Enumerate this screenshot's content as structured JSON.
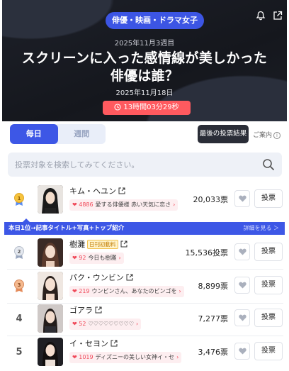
{
  "header": {
    "category_tag": "俳優・映画・ドラマ女子",
    "week_label": "2025年11月3週目",
    "title_line1": "スクリーンに入った感情線が美しかった",
    "title_line2": "俳優は誰？",
    "date": "2025年11月18日",
    "countdown": "13時間03分29秒",
    "icons": [
      "bell-icon",
      "share-icon"
    ]
  },
  "tabs": [
    {
      "label": "毎日",
      "active": true
    },
    {
      "label": "週間",
      "active": false
    }
  ],
  "last_result_label": "最後の投票結果",
  "guide_label": "ご案内",
  "search": {
    "placeholder": "投票対象を検索してみてください。"
  },
  "feature_banner": {
    "text": "本日1位→記事タイトル+写真+トップ紹介",
    "more": "詳細を見る ＞"
  },
  "vote_label": "投票",
  "rows": [
    {
      "rank": "1",
      "name": "キム・ヘユン",
      "badge": "",
      "comment_count": "4886",
      "comment": "愛する俳優様 赤い天気に恋さ",
      "votes": "20,033票"
    },
    {
      "rank": "2",
      "name": "樹灘",
      "badge": "日刊初動料",
      "comment_count": "92",
      "comment": "今日も樹灘",
      "votes": "15,536投票"
    },
    {
      "rank": "3",
      "name": "パク・ウンビン",
      "badge": "",
      "comment_count": "219",
      "comment": "ウンビンさん、あなたのビンゴを",
      "votes": "8,899票"
    },
    {
      "rank": "4",
      "name": "ゴアラ",
      "badge": "",
      "comment_count": "52",
      "comment": "♡♡♡♡♡♡♡♡♡",
      "votes": "7,277票"
    },
    {
      "rank": "5",
      "name": "イ・セヨン",
      "badge": "",
      "comment_count": "1019",
      "comment": "ディズニーの美しい女神イ・セ",
      "votes": "3,476票"
    }
  ],
  "colors": {
    "accent": "#3d57e6",
    "timer": "#ff5a5f",
    "heart": "#f04a5a",
    "dark_button": "#2a2d37"
  }
}
